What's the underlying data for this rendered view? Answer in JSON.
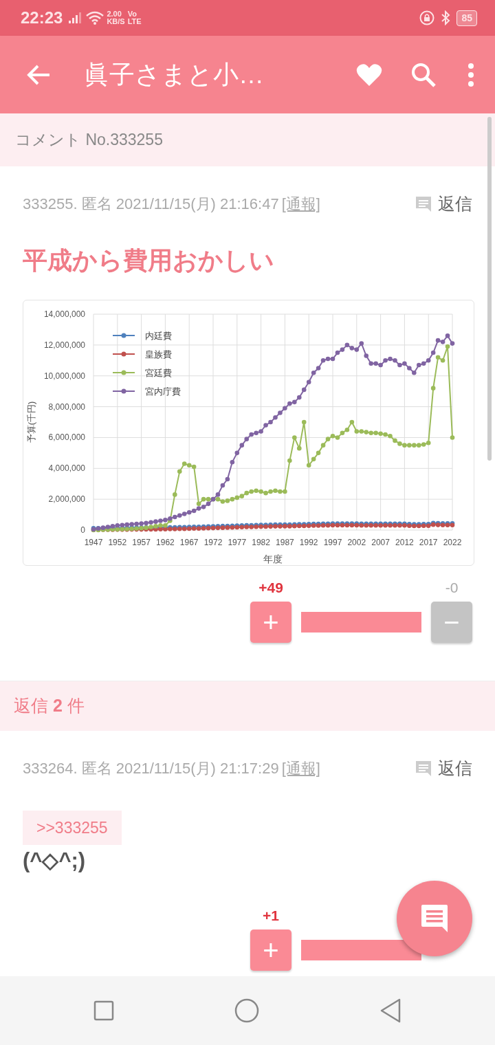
{
  "status_bar": {
    "time": "22:23",
    "net_speed": "2.00",
    "net_unit": "KB/S",
    "net_top": "Vo",
    "net_bottom": "LTE",
    "battery": "85"
  },
  "app_bar": {
    "title": "眞子さまと小…"
  },
  "section_header": "コメント No.333255",
  "comment": {
    "meta": "333255. 匿名 2021/11/15(月) 21:16:47",
    "report": "[通報]",
    "reply_label": "返信",
    "title": "平成から費用おかしい",
    "chart_data": {
      "type": "line",
      "xlabel": "年度",
      "ylabel": "予算(千円)",
      "xlim": [
        1947,
        2022
      ],
      "ylim": [
        0,
        14000000
      ],
      "grid": true,
      "legend": true,
      "yticks": [
        {
          "value": 0,
          "label": "0"
        },
        {
          "value": 2000000,
          "label": "2,000,000"
        },
        {
          "value": 4000000,
          "label": "4,000,000"
        },
        {
          "value": 6000000,
          "label": "6,000,000"
        },
        {
          "value": 8000000,
          "label": "8,000,000"
        },
        {
          "value": 10000000,
          "label": "10,000,000"
        },
        {
          "value": 12000000,
          "label": "12,000,000"
        },
        {
          "value": 14000000,
          "label": "14,000,000"
        }
      ],
      "xticks": [
        1947,
        1952,
        1957,
        1962,
        1967,
        1972,
        1977,
        1982,
        1987,
        1992,
        1997,
        2002,
        2007,
        2012,
        2017,
        2022
      ],
      "x": [
        1947,
        1948,
        1949,
        1950,
        1951,
        1952,
        1953,
        1954,
        1955,
        1956,
        1957,
        1958,
        1959,
        1960,
        1961,
        1962,
        1963,
        1964,
        1965,
        1966,
        1967,
        1968,
        1969,
        1970,
        1971,
        1972,
        1973,
        1974,
        1975,
        1976,
        1977,
        1978,
        1979,
        1980,
        1981,
        1982,
        1983,
        1984,
        1985,
        1986,
        1987,
        1988,
        1989,
        1990,
        1991,
        1992,
        1993,
        1994,
        1995,
        1996,
        1997,
        1998,
        1999,
        2000,
        2001,
        2002,
        2003,
        2004,
        2005,
        2006,
        2007,
        2008,
        2009,
        2010,
        2011,
        2012,
        2013,
        2014,
        2015,
        2016,
        2017,
        2018,
        2019,
        2020,
        2021,
        2022
      ],
      "series": [
        {
          "name": "内廷費",
          "color": "#4f81bd",
          "marker": "circle",
          "values": [
            120000,
            120000,
            130000,
            130000,
            130000,
            140000,
            140000,
            140000,
            150000,
            150000,
            150000,
            160000,
            160000,
            160000,
            170000,
            170000,
            180000,
            180000,
            190000,
            190000,
            200000,
            210000,
            210000,
            220000,
            230000,
            240000,
            250000,
            260000,
            270000,
            280000,
            290000,
            300000,
            310000,
            310000,
            320000,
            330000,
            330000,
            340000,
            350000,
            350000,
            360000,
            360000,
            370000,
            380000,
            380000,
            390000,
            400000,
            400000,
            410000,
            410000,
            420000,
            420000,
            420000,
            420000,
            420000,
            420000,
            410000,
            410000,
            410000,
            410000,
            410000,
            410000,
            410000,
            410000,
            410000,
            410000,
            390000,
            380000,
            380000,
            390000,
            390000,
            460000,
            440000,
            430000,
            430000,
            430000
          ]
        },
        {
          "name": "皇族費",
          "color": "#c0504d",
          "marker": "circle",
          "values": [
            10000,
            10000,
            20000,
            20000,
            20000,
            30000,
            30000,
            30000,
            40000,
            40000,
            40000,
            50000,
            50000,
            50000,
            60000,
            60000,
            70000,
            70000,
            80000,
            80000,
            90000,
            100000,
            100000,
            110000,
            120000,
            130000,
            140000,
            150000,
            160000,
            170000,
            180000,
            190000,
            200000,
            200000,
            210000,
            220000,
            220000,
            230000,
            240000,
            240000,
            250000,
            250000,
            260000,
            270000,
            270000,
            280000,
            290000,
            290000,
            300000,
            300000,
            310000,
            310000,
            310000,
            310000,
            310000,
            310000,
            300000,
            300000,
            300000,
            300000,
            300000,
            300000,
            300000,
            300000,
            300000,
            300000,
            280000,
            270000,
            270000,
            280000,
            280000,
            350000,
            330000,
            320000,
            320000,
            320000
          ]
        },
        {
          "name": "宮廷費",
          "color": "#9bbb59",
          "marker": "circle",
          "values": [
            0,
            0,
            20000,
            30000,
            50000,
            50000,
            60000,
            70000,
            80000,
            100000,
            120000,
            150000,
            200000,
            250000,
            300000,
            300000,
            600000,
            2300000,
            3800000,
            4300000,
            4200000,
            4100000,
            1700000,
            2000000,
            2000000,
            2000000,
            2000000,
            1850000,
            1900000,
            2000000,
            2100000,
            2200000,
            2400000,
            2500000,
            2550000,
            2500000,
            2400000,
            2500000,
            2550000,
            2500000,
            2500000,
            4500000,
            6000000,
            5300000,
            7000000,
            4200000,
            4600000,
            5000000,
            5500000,
            5900000,
            6100000,
            6000000,
            6300000,
            6500000,
            7000000,
            6400000,
            6400000,
            6350000,
            6300000,
            6300000,
            6250000,
            6200000,
            6100000,
            5800000,
            5600000,
            5500000,
            5500000,
            5500000,
            5500000,
            5550000,
            5650000,
            9200000,
            11200000,
            11000000,
            11900000,
            6000000
          ]
        },
        {
          "name": "宮内庁費",
          "color": "#8064a2",
          "marker": "circle",
          "values": [
            50000,
            100000,
            150000,
            200000,
            250000,
            300000,
            320000,
            350000,
            380000,
            400000,
            420000,
            450000,
            500000,
            550000,
            600000,
            650000,
            750000,
            850000,
            950000,
            1050000,
            1150000,
            1250000,
            1400000,
            1500000,
            1700000,
            2000000,
            2300000,
            2900000,
            3300000,
            4400000,
            5000000,
            5500000,
            5900000,
            6200000,
            6300000,
            6400000,
            6800000,
            7000000,
            7300000,
            7600000,
            7900000,
            8200000,
            8300000,
            8600000,
            9100000,
            9600000,
            10200000,
            10500000,
            11000000,
            11100000,
            11100000,
            11500000,
            11700000,
            12000000,
            11800000,
            11700000,
            12100000,
            11300000,
            10800000,
            10800000,
            10700000,
            11000000,
            11100000,
            11000000,
            10700000,
            10800000,
            10500000,
            10200000,
            10700000,
            10800000,
            11000000,
            11500000,
            12300000,
            12200000,
            12600000,
            12100000
          ]
        }
      ]
    },
    "votes": {
      "plus": "+49",
      "plus_button": "+",
      "minus": "-0",
      "minus_button": "−"
    }
  },
  "replies_header": "返信 **2** 件",
  "replies": [
    {
      "meta": "333264. 匿名 2021/11/15(月) 21:17:29",
      "report": "[通報]",
      "reply_label": "返信",
      "anchor": ">>333255",
      "body": "(^◇^;)",
      "votes": {
        "plus": "+1",
        "plus_button": "+"
      }
    }
  ]
}
